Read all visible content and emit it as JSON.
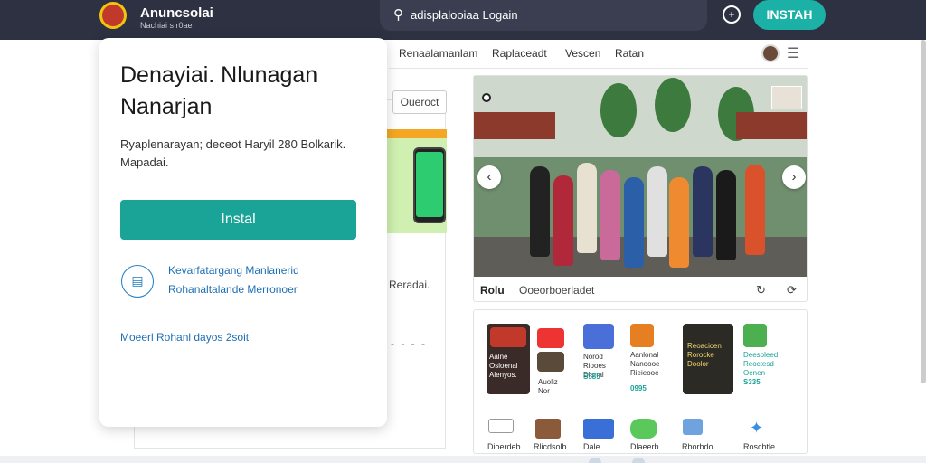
{
  "header": {
    "brand_name": "Anuncsolai",
    "brand_sub": "Nachiai s r0ae",
    "search_text": "adisplalooiaa Logain",
    "install_label": "INSTAH"
  },
  "nav": {
    "items": [
      "Renaalamanlam",
      "Raplaceadt",
      "Vescen",
      "Ratan"
    ]
  },
  "modal": {
    "title": "Denayiai. Nlunagan Nanarjan",
    "description": "Ryaplenarayan; deceot Haryil 280 Bolkarik. Mapadai.",
    "install_label": "Instal",
    "link_line1": "Kevarfatargang Manlanerid",
    "link_line2": "Rohanaltalande Merronoer",
    "footer": "Moeerl   Rohanl dayos 2soit"
  },
  "behind": {
    "chip_label": "Oueroct",
    "side_text": "Reradai.",
    "dots": "- - - -"
  },
  "photo_card": {
    "footer_bold": "Rolu",
    "footer_text": "Ooeorboerladet"
  },
  "apps": {
    "tiles": [
      {
        "text": "Aalne Osloenal Alenyos.",
        "price": ""
      },
      {
        "text": "Auoliz Nor",
        "price": ""
      },
      {
        "text": "Norod Riooes Dlanal",
        "price": "S585"
      },
      {
        "text": "Aanlonal Nanoooe Rieieooe",
        "price": "0995"
      },
      {
        "text": "Reoacicen Rorocke Doolor",
        "price": ""
      },
      {
        "text": "Deesoleed Reoctesd Oenen",
        "price": "S335"
      }
    ],
    "shortcuts": [
      "Dioerdeb",
      "Rlicdsolb",
      "Dale",
      "Dlaeerb",
      "Rborbdo",
      "Roscbtle"
    ]
  },
  "colors": {
    "accent": "#1aa397",
    "topbar": "#2d3142",
    "link": "#1e6fb5"
  }
}
